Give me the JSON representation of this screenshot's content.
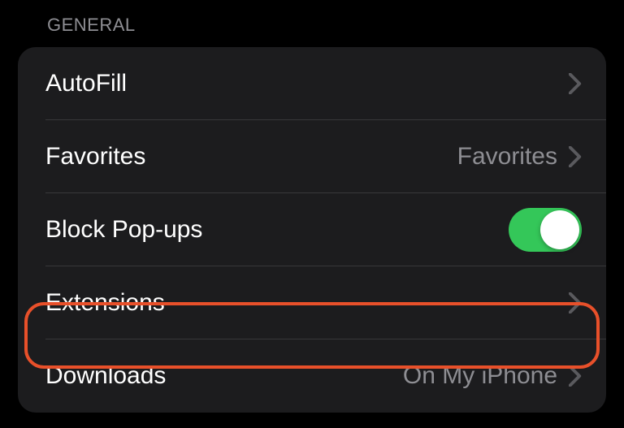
{
  "section": {
    "header": "GENERAL",
    "rows": {
      "autofill": {
        "label": "AutoFill"
      },
      "favorites": {
        "label": "Favorites",
        "value": "Favorites"
      },
      "block_popups": {
        "label": "Block Pop-ups",
        "toggle_on": true
      },
      "extensions": {
        "label": "Extensions"
      },
      "downloads": {
        "label": "Downloads",
        "value": "On My iPhone"
      }
    }
  },
  "colors": {
    "accent_highlight": "#e8502a",
    "toggle_on": "#34c759"
  }
}
